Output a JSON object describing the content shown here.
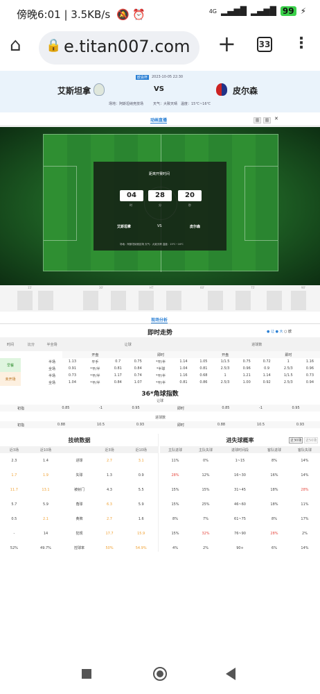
{
  "status": {
    "time": "傍晚6:01",
    "speed": "3.5KB/s",
    "network": "4G",
    "battery": "99"
  },
  "browser": {
    "url": "e.titan007.com",
    "tab_count": "33"
  },
  "match": {
    "league": "欧会杯",
    "datetime": "2023-10-05 22:30",
    "home": "艾斯坦拿",
    "away": "皮尔森",
    "vs": "VS",
    "venue": "场地：阿斯坦纳竞技场",
    "weather": "天气：大致天晴",
    "temperature": "温度：15℃~16℃"
  },
  "anim": {
    "tab": "动画直播",
    "btn1": "图",
    "btn2": "图"
  },
  "countdown": {
    "title": "距离开赛时间",
    "hours": "04",
    "minutes": "28",
    "seconds": "20",
    "h_unit": "时",
    "m_unit": "分",
    "s_unit": "秒",
    "home": "艾斯坦拿",
    "vs": "VS",
    "away": "皮尔森",
    "footer": "场地：阿斯坦纳竞技场 天气：大致天晴 温度：15℃~16℃"
  },
  "strip_labels": [
    "15'",
    "30'",
    "HT",
    "60'",
    "75'",
    "90'"
  ],
  "live_tab": "现场分析",
  "trend": {
    "title": "即时走势",
    "filters": [
      "让",
      "大",
      "欧"
    ],
    "headers": [
      "时间",
      "比分",
      "半全场",
      "让球",
      "进球数"
    ],
    "sub_headers": [
      "开盘",
      "即时",
      "开盘",
      "即时"
    ],
    "row_labels": [
      "早餐",
      "未开场"
    ],
    "rows": [
      [
        "半场",
        "1.13",
        "平手",
        "0.7",
        "0.75",
        "*平/半",
        "1.14",
        "1.05",
        "1/1.5",
        "0.75",
        "0.72",
        "1",
        "1.16"
      ],
      [
        "全场",
        "0.91",
        "*平/半",
        "0.81",
        "0.84",
        "*半球",
        "1.04",
        "0.81",
        "2.5/3",
        "0.96",
        "0.9",
        "2.5/3",
        "0.96"
      ],
      [
        "半场",
        "0.73",
        "*平/半",
        "1.17",
        "0.74",
        "*平/半",
        "1.16",
        "0.68",
        "1",
        "1.21",
        "1.14",
        "1/1.5",
        "0.73"
      ],
      [
        "全场",
        "1.04",
        "*平/半",
        "0.84",
        "1.07",
        "*平/半",
        "0.81",
        "0.86",
        "2.5/3",
        "1.00",
        "0.92",
        "2.5/3",
        "0.94"
      ]
    ]
  },
  "corner": {
    "title": "36*角球指数",
    "sub1": "让球",
    "sub2": "进球数",
    "rows": [
      [
        "初指",
        "0.85",
        "-1",
        "0.95",
        "即时",
        "0.85",
        "-1",
        "0.95"
      ],
      [
        "初指",
        "0.88",
        "10.5",
        "0.93",
        "即时",
        "0.88",
        "10.5",
        "0.93"
      ]
    ]
  },
  "tech": {
    "title": "技统数据",
    "headers": [
      "近3场",
      "近10场",
      "",
      "近3场",
      "近10场"
    ],
    "rows": [
      [
        "2.3",
        "1.4",
        "进球",
        "2.7",
        "3.1"
      ],
      [
        "1.7",
        "1.9",
        "失球",
        "1.3",
        "0.9"
      ],
      [
        "11.7",
        "13.1",
        "被射门",
        "4.3",
        "5.5"
      ],
      [
        "5.7",
        "5.9",
        "角球",
        "6.3",
        "5.9"
      ],
      [
        "0.5",
        "2.1",
        "黄牌",
        "2.7",
        "1.6"
      ],
      [
        "-",
        "14",
        "犯规",
        "17.7",
        "15.9"
      ],
      [
        "52%",
        "49.7%",
        "控球率",
        "50%",
        "54.9%"
      ]
    ]
  },
  "goal_prob": {
    "title": "进失球概率",
    "btn_active": "近30场",
    "btn_other": "近50场",
    "headers": [
      "主队进球",
      "主队失球",
      "进球时间段",
      "客队进球",
      "客队失球"
    ],
    "rows": [
      [
        "11%",
        "0%",
        "1~15",
        "8%",
        "14%"
      ],
      [
        "28%",
        "12%",
        "16~30",
        "16%",
        "14%"
      ],
      [
        "15%",
        "15%",
        "31~45",
        "18%",
        "28%"
      ],
      [
        "15%",
        "25%",
        "46~60",
        "18%",
        "11%"
      ],
      [
        "8%",
        "7%",
        "61~75",
        "8%",
        "17%"
      ],
      [
        "15%",
        "32%",
        "76~90",
        "28%",
        "2%"
      ],
      [
        "4%",
        "2%",
        "90+",
        "6%",
        "14%"
      ]
    ]
  }
}
